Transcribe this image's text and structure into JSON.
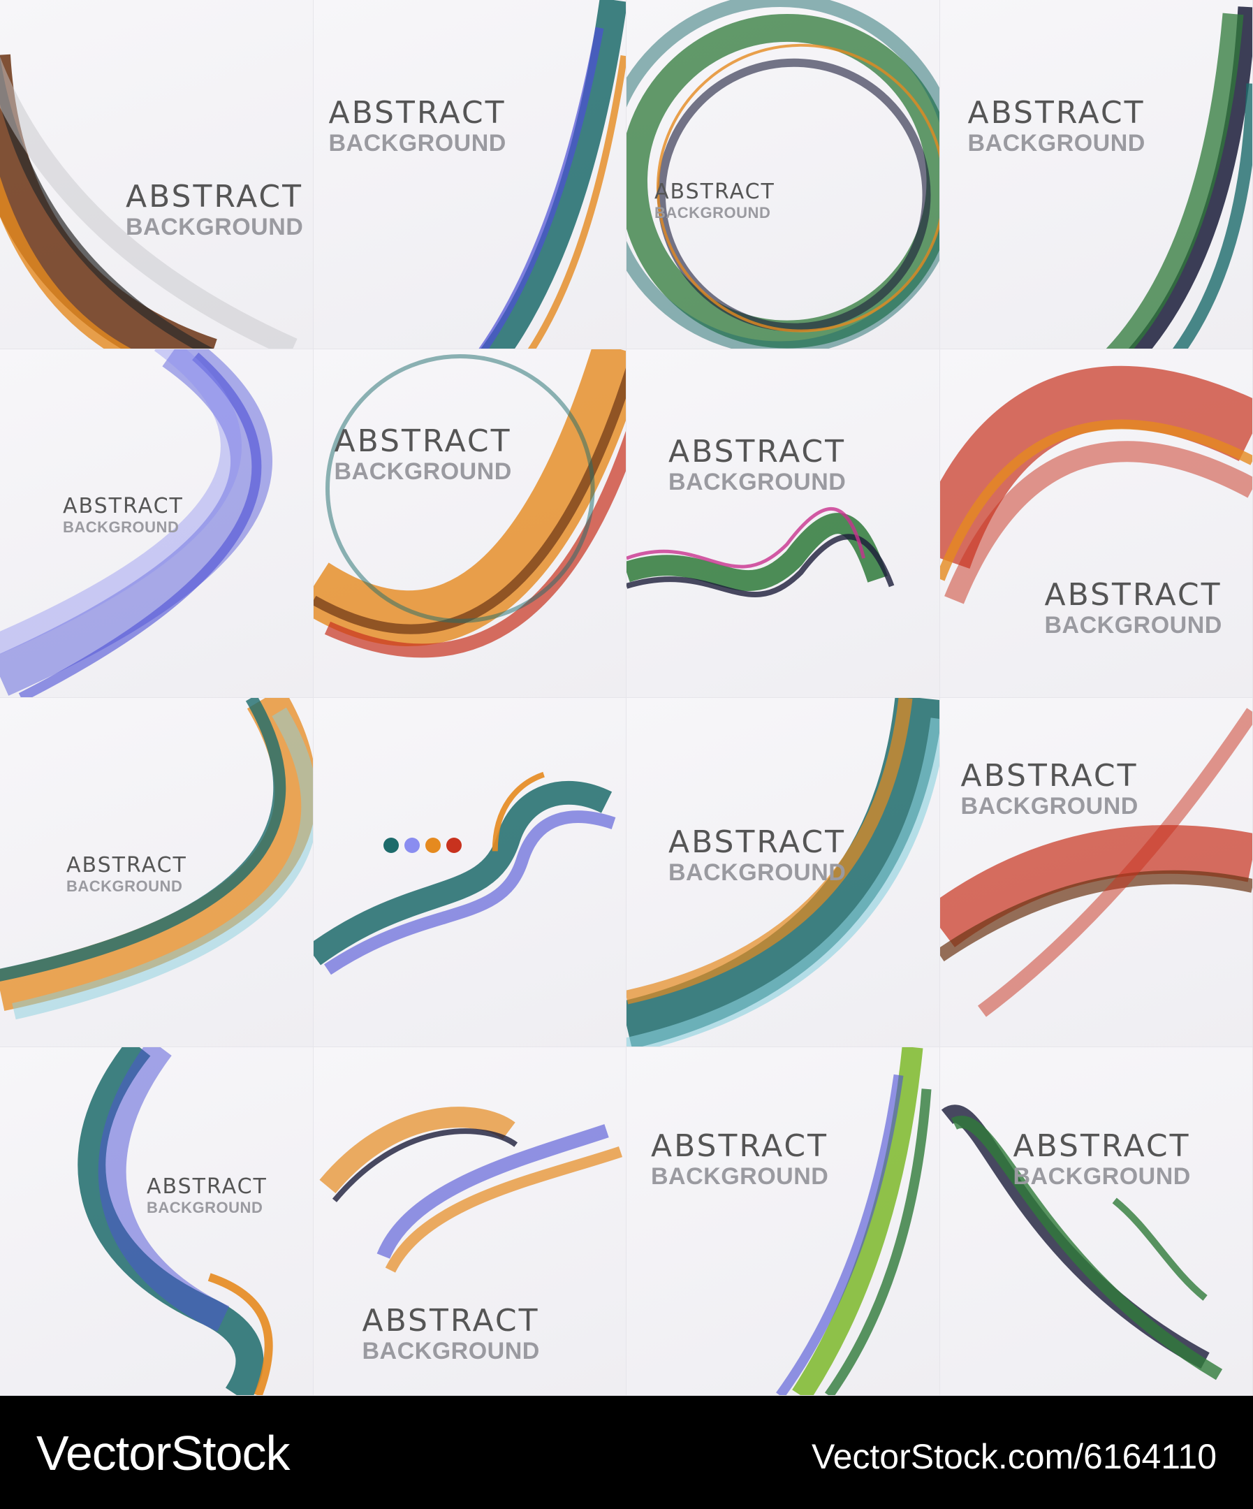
{
  "logo": {
    "line1": "ABSTRACT",
    "line2": "BACKGROUND"
  },
  "footer": {
    "brand": "VectorStock",
    "image_id": "VectorStock.com/6164110"
  },
  "colors": {
    "brown": "#6b3414",
    "teal": "#1d6b6b",
    "green": "#2f7a3a",
    "blue": "#4b4fd6",
    "orange": "#e58a1f",
    "red": "#c8321e",
    "navy": "#1b1d3a",
    "footer": "#000000"
  },
  "tiles": [
    {
      "label": "brown-swirl-tile"
    },
    {
      "label": "teal-edge-tile"
    },
    {
      "label": "green-rings-tile"
    },
    {
      "label": "green-edge-tile"
    },
    {
      "label": "blue-arc-tile"
    },
    {
      "label": "orange-circle-tile"
    },
    {
      "label": "green-wave-tile"
    },
    {
      "label": "red-arc-tile"
    },
    {
      "label": "teal-orange-circle-tile"
    },
    {
      "label": "teal-ribbon-tile"
    },
    {
      "label": "teal-brown-arc-tile"
    },
    {
      "label": "red-wave-tile"
    },
    {
      "label": "blue-teal-ribbon-tile"
    },
    {
      "label": "gold-swirl-tile"
    },
    {
      "label": "green-stripes-tile"
    },
    {
      "label": "dark-green-tile"
    }
  ]
}
